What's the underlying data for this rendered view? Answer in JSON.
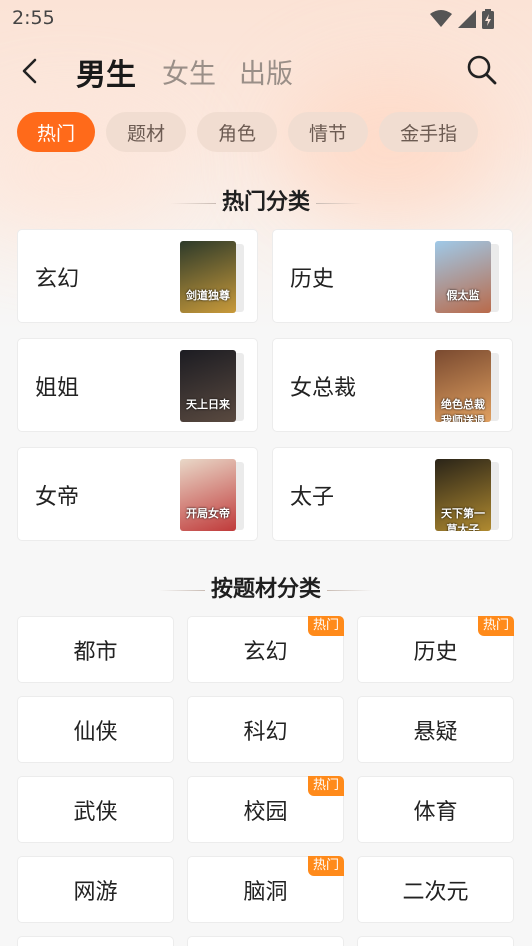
{
  "status_bar": {
    "time": "2:55"
  },
  "header": {
    "tabs": [
      {
        "label": "男生",
        "active": true
      },
      {
        "label": "女生",
        "active": false
      },
      {
        "label": "出版",
        "active": false
      }
    ]
  },
  "chips": [
    {
      "label": "热门",
      "active": true
    },
    {
      "label": "题材",
      "active": false
    },
    {
      "label": "角色",
      "active": false
    },
    {
      "label": "情节",
      "active": false
    },
    {
      "label": "金手指",
      "active": false
    }
  ],
  "hot_section": {
    "title": "热门分类",
    "cards": [
      {
        "name": "玄幻",
        "cover_text": "剑道独尊",
        "cover_colors": [
          "#2d3a2a",
          "#c99a3a"
        ]
      },
      {
        "name": "历史",
        "cover_text": "假太监",
        "cover_colors": [
          "#9fc9e8",
          "#b96a4a"
        ]
      },
      {
        "name": "姐姐",
        "cover_text": "天上日来",
        "cover_colors": [
          "#1c1c22",
          "#5a4a40"
        ]
      },
      {
        "name": "女总裁",
        "cover_text": "绝色总裁 我师送退",
        "cover_colors": [
          "#7a4a30",
          "#e0a060"
        ]
      },
      {
        "name": "女帝",
        "cover_text": "开局女帝",
        "cover_colors": [
          "#e9d8c8",
          "#c03a3a"
        ]
      },
      {
        "name": "太子",
        "cover_text": "天下第一 草太子",
        "cover_colors": [
          "#2a2418",
          "#b08a30"
        ]
      }
    ]
  },
  "topic_section": {
    "title": "按题材分类",
    "badge_label": "热门",
    "items": [
      {
        "label": "都市",
        "hot": false
      },
      {
        "label": "玄幻",
        "hot": true
      },
      {
        "label": "历史",
        "hot": true
      },
      {
        "label": "仙侠",
        "hot": false
      },
      {
        "label": "科幻",
        "hot": false
      },
      {
        "label": "悬疑",
        "hot": false
      },
      {
        "label": "武侠",
        "hot": false
      },
      {
        "label": "校园",
        "hot": true
      },
      {
        "label": "体育",
        "hot": false
      },
      {
        "label": "网游",
        "hot": false
      },
      {
        "label": "脑洞",
        "hot": true
      },
      {
        "label": "二次元",
        "hot": false
      }
    ]
  },
  "colors": {
    "accent": "#ff6a1a",
    "badge": "#ff8a1a"
  }
}
